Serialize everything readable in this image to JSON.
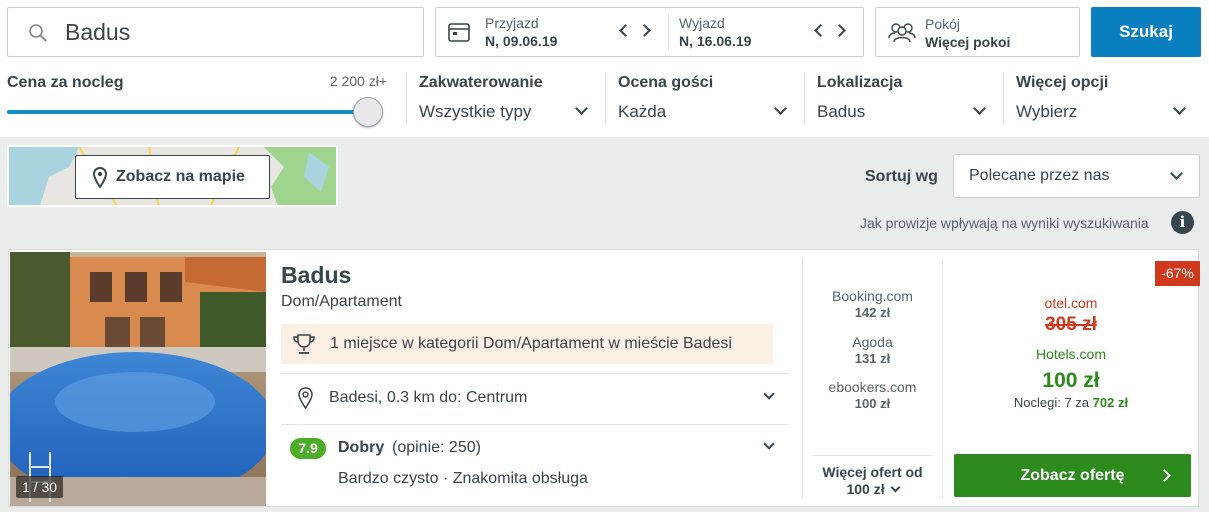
{
  "search": {
    "value": "Badus"
  },
  "checkin": {
    "label": "Przyjazd",
    "date": "N, 09.06.19"
  },
  "checkout": {
    "label": "Wyjazd",
    "date": "N, 16.06.19"
  },
  "rooms": {
    "label": "Pokój",
    "value": "Więcej pokoi"
  },
  "search_button": "Szukaj",
  "filters": {
    "price": {
      "label": "Cena za nocleg",
      "max": "2 200 zł+",
      "level_fraction": 1.0
    },
    "accommodation": {
      "label": "Zakwaterowanie",
      "value": "Wszystkie typy"
    },
    "rating": {
      "label": "Ocena gości",
      "value": "Każda"
    },
    "location": {
      "label": "Lokalizacja",
      "value": "Badus"
    },
    "more": {
      "label": "Więcej opcji",
      "value": "Wybierz"
    }
  },
  "map_button": "Zobacz na mapie",
  "sort": {
    "label": "Sortuj wg",
    "value": "Polecane przez nas"
  },
  "commission_note": "Jak prowizje wpływają na wyniki wyszukiwania",
  "result": {
    "photo_counter": "1 / 30",
    "name": "Badus",
    "type": "Dom/Apartament",
    "award": "1 miejsce w kategorii Dom/Apartament w mieście Badesi",
    "location": "Badesi, 0.3 km do: Centrum",
    "rating_score": "7.9",
    "rating_label": "Dobry",
    "rating_count": "(opinie: 250)",
    "highlights": "Bardzo czysto · Znakomita obsługa",
    "offers": [
      {
        "site": "Booking.com",
        "price": "142 zł"
      },
      {
        "site": "Agoda",
        "price": "131 zł"
      },
      {
        "site": "ebookers.com",
        "price": "100 zł"
      }
    ],
    "more_offers_line1": "Więcej ofert od",
    "more_offers_line2": "100 zł",
    "discount": "-67%",
    "old_site": "otel.com",
    "old_price": "305 zł",
    "best_site": "Hotels.com",
    "best_price": "100 zł",
    "nights_prefix": "Noclegi: 7 za",
    "nights_total": "702 zł",
    "cta": "Zobacz ofertę"
  },
  "colors": {
    "accent_blue": "#0a7fbf",
    "slider_blue": "#0a8fc0",
    "green": "#2d8a1c",
    "rating_green": "#4cae26",
    "discount_red": "#d0391b",
    "award_bg": "#fcf0e4"
  }
}
